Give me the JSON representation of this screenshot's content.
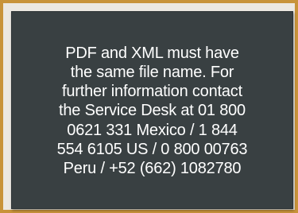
{
  "tooltip": {
    "lines": [
      "PDF and XML must have",
      "the same file name. For",
      "further information contact",
      "the Service Desk at 01 800",
      "0621 331 Mexico / 1 844",
      "554 6105 US / 0 800 00763",
      "Peru / +52 (662) 1082780"
    ]
  },
  "colors": {
    "frame_border": "#c8933a",
    "tooltip_background": "#394042",
    "tooltip_text": "#ffffff"
  }
}
